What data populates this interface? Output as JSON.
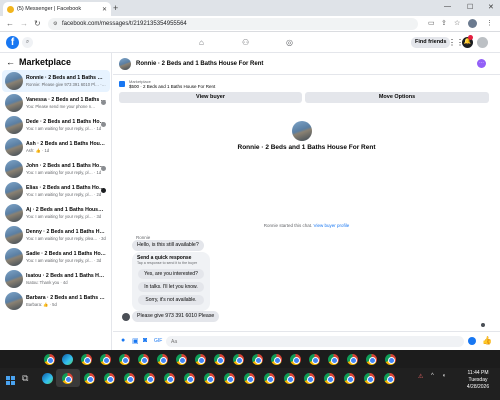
{
  "browser": {
    "tab_title": "(5) Messenger | Facebook",
    "url": "facebook.com/messages/t/2192135354955564"
  },
  "fb": {
    "find_friends": "Find friends"
  },
  "sidebar": {
    "title": "Marketplace",
    "items": [
      {
        "name": "Ronnie · 2 Beds and 1 Baths House…",
        "preview": "Ronnie: Please give 973 391 6010 Pl… · 10m"
      },
      {
        "name": "Vanessa · 2 Beds and 1 Baths H…",
        "preview": "You: Please send me your phone n…"
      },
      {
        "name": "Dede · 2 Beds and 1 Baths House…",
        "preview": "You: I am waiting for your reply, pl… · 1d"
      },
      {
        "name": "Ash · 2 Beds and 1 Baths House…",
        "preview": "Ash: 👍 · 1d"
      },
      {
        "name": "John · 2 Beds and 1 Baths House…",
        "preview": "You: I am waiting for your reply, pl… · 1d"
      },
      {
        "name": "Elias · 2 Beds and 1 Baths House…",
        "preview": "You: I am waiting for your reply, pl… · 2d"
      },
      {
        "name": "Aj · 2 Beds and 1 Baths House F…",
        "preview": "You: I am waiting for your reply, pl… · 3d"
      },
      {
        "name": "Denny · 2 Beds and 1 Baths House…",
        "preview": "You: I am waiting for your reply, plea… · 3d"
      },
      {
        "name": "Sadie · 2 Beds and 1 Baths House…",
        "preview": "You: I am waiting for your reply, pl… · 3d"
      },
      {
        "name": "Isatou · 2 Beds and 1 Baths House …",
        "preview": "Isatou: Thank you · 4d"
      },
      {
        "name": "Barbara · 2 Beds and 1 Baths House…",
        "preview": "Barbara: 👍 · 5d"
      }
    ]
  },
  "chat": {
    "title": "Ronnie · 2 Beds and 1 Baths House For Rent",
    "marketplace_label": "Marketplace",
    "listing_desc": "$500 · 2 Beds and 1 Baths House For Rent",
    "view_buyer": "View buyer",
    "more_options": "Move Options",
    "listing_title": "Ronnie · 2 Beds and 1 Baths House For Rent",
    "started_text": "Ronnie started this chat.",
    "view_profile": "View buyer profile",
    "sender_name": "Ronnie",
    "message1": "Hello, is this still available?",
    "quick_title": "Send a quick response",
    "quick_sub": "Tap a response to send it to the buyer",
    "quick_responses": [
      "Yes, are you interested?",
      "In talks. I'll let you know.",
      "Sorry, it's not available."
    ],
    "message2": "Please give 973 391 6010 Please",
    "input_placeholder": "Aa"
  },
  "taskbar": {
    "time": "11:44 PM",
    "day": "Tuesday",
    "date": "4/28/2026"
  }
}
